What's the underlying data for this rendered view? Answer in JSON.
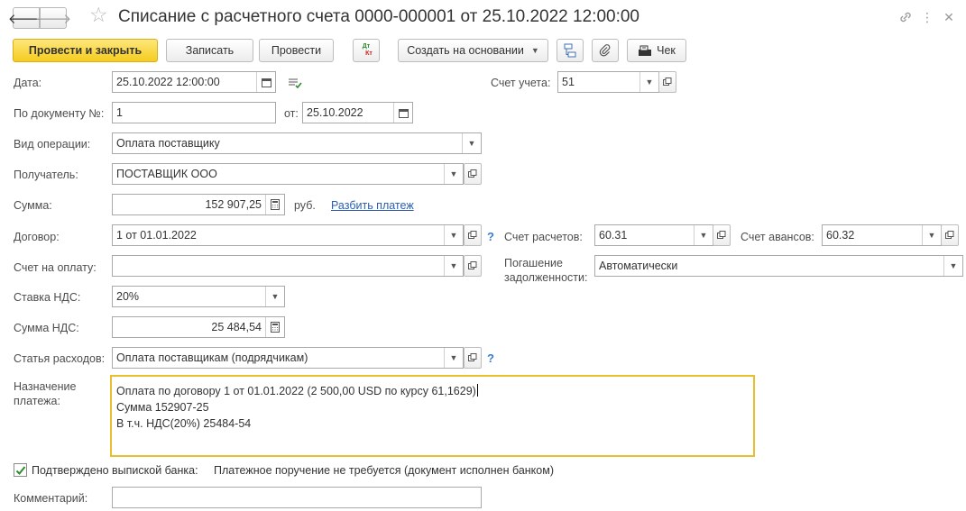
{
  "window": {
    "title": "Списание с расчетного счета 0000-000001 от 25.10.2022 12:00:00",
    "nav_back_icon": "arrow-left-icon",
    "nav_forward_icon": "arrow-right-icon"
  },
  "toolbar": {
    "post_and_close": "Провести и закрыть",
    "save": "Записать",
    "post": "Провести",
    "dt_kt_top": "Дт",
    "dt_kt_bottom": "Кт",
    "create_based_on": "Создать на основании",
    "check": "Чек"
  },
  "form": {
    "date": {
      "label": "Дата:",
      "value": "25.10.2022 12:00:00"
    },
    "account": {
      "label": "Счет учета:",
      "value": "51"
    },
    "doc_number": {
      "label": "По документу №:",
      "value": "1",
      "from_label": "от:",
      "from_value": "25.10.2022"
    },
    "operation_type": {
      "label": "Вид операции:",
      "value": "Оплата поставщику"
    },
    "recipient": {
      "label": "Получатель:",
      "value": "ПОСТАВЩИК ООО"
    },
    "amount": {
      "label": "Сумма:",
      "value": "152 907,25",
      "currency": "руб.",
      "split_link": "Разбить платеж"
    },
    "contract": {
      "label": "Договор:",
      "value": "1 от 01.01.2022",
      "help": "?"
    },
    "settlement_account": {
      "label": "Счет расчетов:",
      "value": "60.31"
    },
    "advance_account": {
      "label": "Счет авансов:",
      "value": "60.32"
    },
    "invoice": {
      "label": "Счет на оплату:",
      "value": ""
    },
    "debt_repayment": {
      "label_line1": "Погашение",
      "label_line2": "задолженности:",
      "value": "Автоматически"
    },
    "vat_rate": {
      "label": "Ставка НДС:",
      "value": "20%"
    },
    "vat_amount": {
      "label": "Сумма НДС:",
      "value": "25 484,54"
    },
    "expense_item": {
      "label": "Статья расходов:",
      "value": "Оплата поставщикам (подрядчикам)",
      "help": "?"
    },
    "purpose": {
      "label_line1": "Назначение",
      "label_line2": "платежа:",
      "line1": "Оплата по договору 1 от 01.01.2022 (2 500,00 USD по курсу 61,1629)",
      "line2": "Сумма 152907-25",
      "line3": "В т.ч. НДС(20%) 25484-54"
    },
    "bank_confirmed": {
      "checked": true,
      "label": "Подтверждено выпиской банка:",
      "note": "Платежное поручение не требуется (документ исполнен банком)"
    },
    "comment": {
      "label": "Комментарий:",
      "value": ""
    }
  },
  "colors": {
    "primary_button": "#f5cc1f",
    "focus_border": "#e9bf2d",
    "link": "#2a5db0",
    "help": "#3a7bd5"
  }
}
